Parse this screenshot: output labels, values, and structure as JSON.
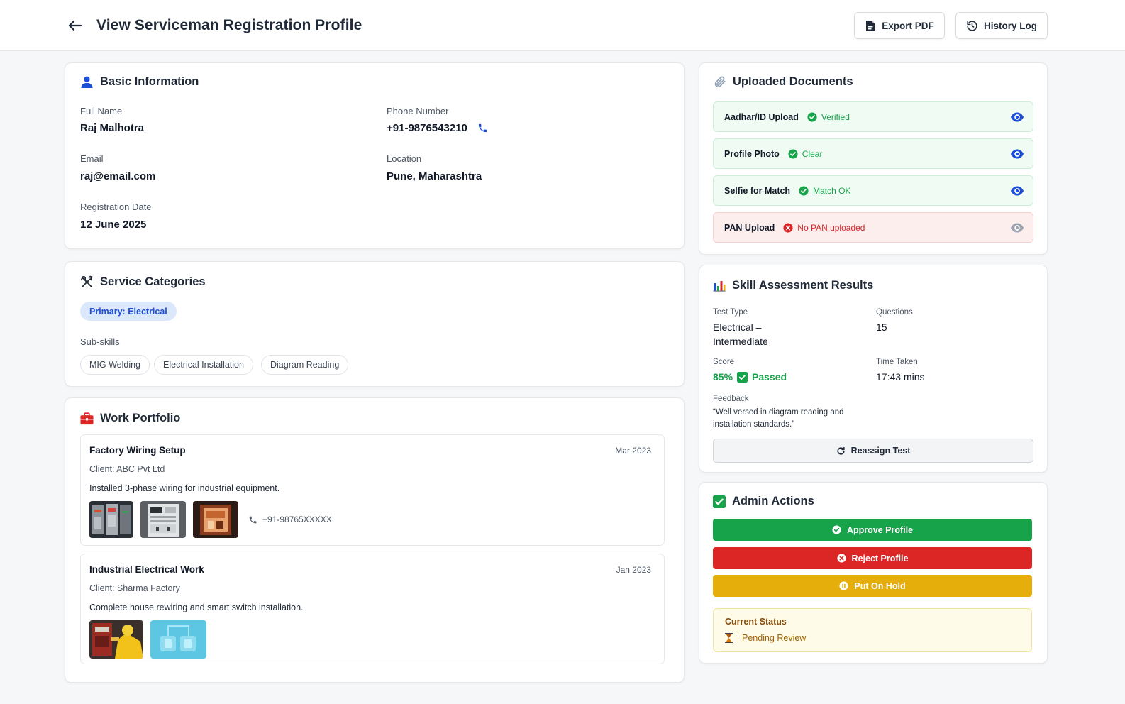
{
  "header": {
    "title": "View Serviceman Registration Profile",
    "export_label": "Export PDF",
    "history_label": "History Log"
  },
  "basic_info": {
    "title": "Basic Information",
    "full_name_label": "Full Name",
    "full_name": "Raj Malhotra",
    "phone_label": "Phone Number",
    "phone": "+91-9876543210",
    "email_label": "Email",
    "email": "raj@email.com",
    "location_label": "Location",
    "location": "Pune, Maharashtra",
    "reg_date_label": "Registration Date",
    "reg_date": "12 June 2025"
  },
  "service_categories": {
    "title": "Service Categories",
    "primary": "Primary: Electrical",
    "subskills_label": "Sub-skills",
    "subskills": [
      "MIG Welding",
      "Electrical Installation",
      "Diagram Reading"
    ]
  },
  "portfolio": {
    "title": "Work Portfolio",
    "items": [
      {
        "title": "Factory Wiring Setup",
        "date": "Mar 2023",
        "client": "Client: ABC Pvt Ltd",
        "description": "Installed 3-phase wiring for industrial equipment.",
        "contact": "+91-98765XXXXX"
      },
      {
        "title": "Industrial Electrical Work",
        "date": "Jan 2023",
        "client": "Client: Sharma Factory",
        "description": "Complete house rewiring and smart switch installation."
      }
    ]
  },
  "documents": {
    "title": "Uploaded Documents",
    "items": [
      {
        "name": "Aadhar/ID Upload",
        "status": "Verified",
        "state": "ok"
      },
      {
        "name": "Profile Photo",
        "status": "Clear",
        "state": "ok"
      },
      {
        "name": "Selfie for Match",
        "status": "Match OK",
        "state": "ok"
      },
      {
        "name": "PAN Upload",
        "status": "No PAN uploaded",
        "state": "missing"
      }
    ]
  },
  "skill_assessment": {
    "title": "Skill Assessment Results",
    "test_type_label": "Test Type",
    "test_type_line1": "Electrical –",
    "test_type_line2": "Intermediate",
    "questions_label": "Questions",
    "questions": "15",
    "score_label": "Score",
    "score": "85%",
    "score_result": "Passed",
    "time_label": "Time Taken",
    "time": "17:43 mins",
    "feedback_label": "Feedback",
    "feedback_line1": "“Well versed in diagram reading and",
    "feedback_line2": "installation standards.”",
    "reassign_label": "Reassign Test"
  },
  "admin_actions": {
    "title": "Admin Actions",
    "approve_label": "Approve Profile",
    "reject_label": "Reject Profile",
    "hold_label": "Put On Hold",
    "status_label": "Current Status",
    "status_value": "Pending Review"
  },
  "colors": {
    "accent_blue": "#1d4ed8",
    "success_green": "#16a34a",
    "approve_green": "#16a34a",
    "reject_red": "#dc2626",
    "hold_yellow": "#eab308",
    "status_bg": "#fefbe8"
  },
  "icons": {
    "back": "arrow-left-icon",
    "export": "pdf-file-icon",
    "history": "history-icon",
    "basic_info": "user-icon",
    "phone": "phone-icon",
    "service": "tools-icon",
    "portfolio": "toolbox-icon",
    "documents": "paperclip-icon",
    "skill": "bar-chart-icon",
    "admin": "checkbox-icon",
    "status": "hourglass-icon"
  }
}
